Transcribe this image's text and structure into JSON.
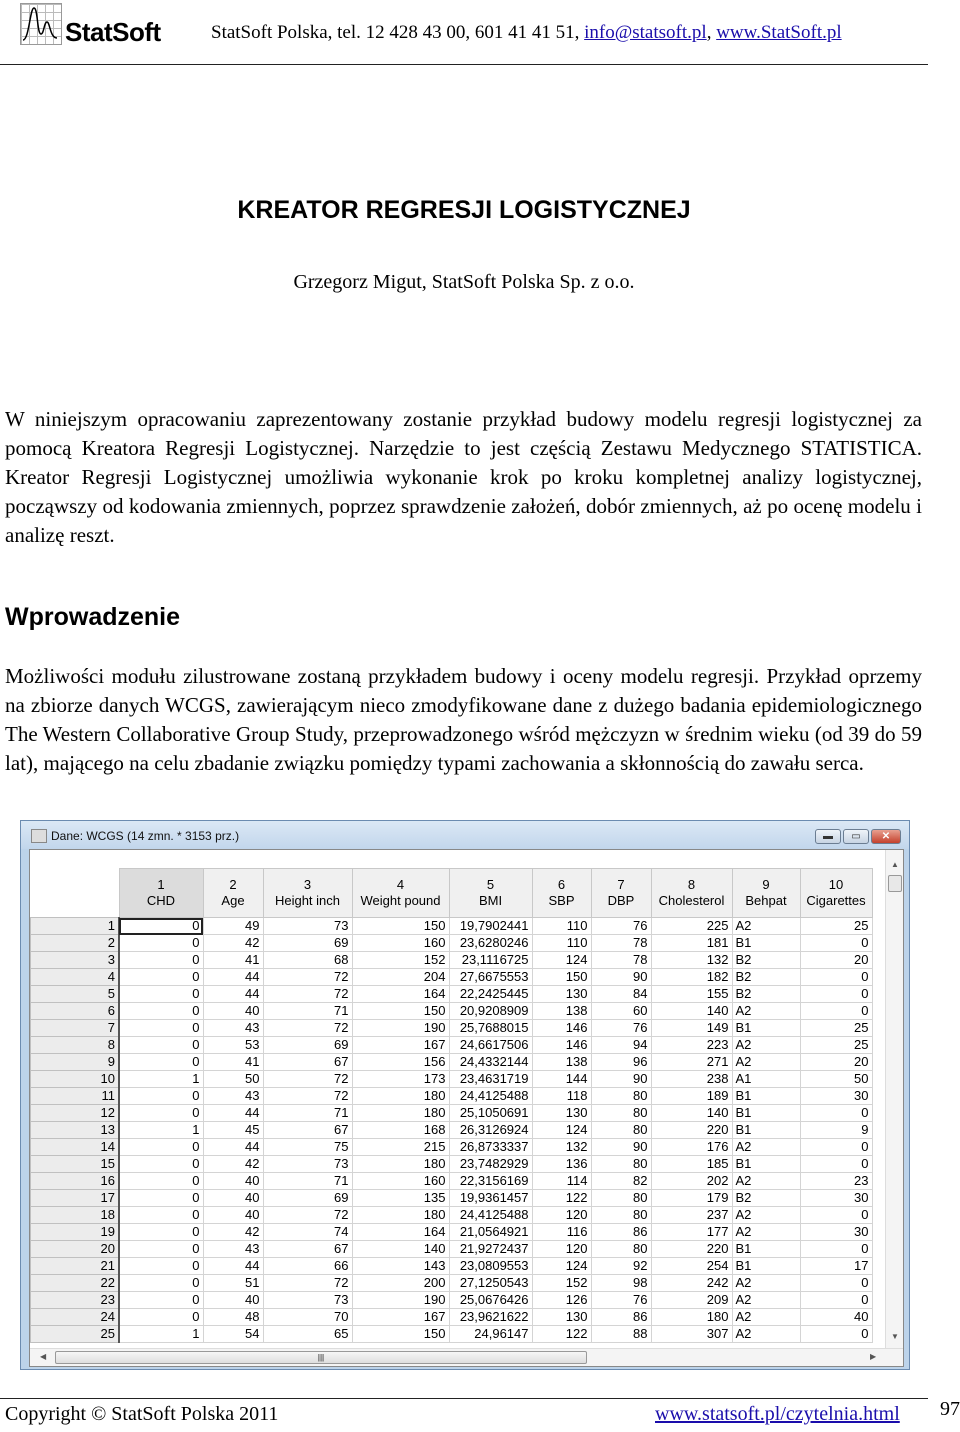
{
  "header": {
    "logo_text": "StatSoft",
    "contact_text": "StatSoft Polska, tel. 12 428 43 00, 601 41 41 51, ",
    "email": "info@statsoft.pl",
    "separator": ", ",
    "website": "www.StatSoft.pl"
  },
  "title": "KREATOR REGRESJI LOGISTYCZNEJ",
  "author": "Grzegorz Migut, StatSoft Polska Sp. z o.o.",
  "intro": "W niniejszym opracowaniu zaprezentowany zostanie przykład budowy modelu regresji logistycznej za pomocą Kreatora Regresji Logistycznej. Narzędzie to jest częścią Zestawu Medycznego STATISTICA. Kreator Regresji Logistycznej umożliwia wykonanie krok po kroku kompletnej analizy logistycznej, począwszy od kodowania zmiennych, poprzez sprawdzenie założeń, dobór zmiennych, aż po ocenę modelu i analizę reszt.",
  "section_heading": "Wprowadzenie",
  "section_text": "Możliwości modułu zilustrowane zostaną przykładem budowy i oceny modelu regresji. Przykład oprzemy na zbiorze danych WCGS, zawierającym nieco zmodyfikowane dane z dużego badania epidemiologicznego The Western Collaborative Group Study, przeprowadzonego wśród mężczyzn w średnim wieku (od 39 do 59 lat), mającego na celu zbadanie związku pomiędzy typami zachowania a skłonnością do zawału serca.",
  "spreadsheet": {
    "window_title": "Dane: WCGS (14 zmn. * 3153 prz.)",
    "columns": [
      {
        "num": "1",
        "name": "CHD"
      },
      {
        "num": "2",
        "name": "Age"
      },
      {
        "num": "3",
        "name": "Height inch"
      },
      {
        "num": "4",
        "name": "Weight pound"
      },
      {
        "num": "5",
        "name": "BMI"
      },
      {
        "num": "6",
        "name": "SBP"
      },
      {
        "num": "7",
        "name": "DBP"
      },
      {
        "num": "8",
        "name": "Cholesterol"
      },
      {
        "num": "9",
        "name": "Behpat"
      },
      {
        "num": "10",
        "name": "Cigarettes"
      }
    ],
    "rows": [
      [
        "1",
        "0",
        "49",
        "73",
        "150",
        "19,7902441",
        "110",
        "76",
        "225",
        "A2",
        "25"
      ],
      [
        "2",
        "0",
        "42",
        "69",
        "160",
        "23,6280246",
        "110",
        "78",
        "181",
        "B1",
        "0"
      ],
      [
        "3",
        "0",
        "41",
        "68",
        "152",
        "23,1116725",
        "124",
        "78",
        "132",
        "B2",
        "20"
      ],
      [
        "4",
        "0",
        "44",
        "72",
        "204",
        "27,6675553",
        "150",
        "90",
        "182",
        "B2",
        "0"
      ],
      [
        "5",
        "0",
        "44",
        "72",
        "164",
        "22,2425445",
        "130",
        "84",
        "155",
        "B2",
        "0"
      ],
      [
        "6",
        "0",
        "40",
        "71",
        "150",
        "20,9208909",
        "138",
        "60",
        "140",
        "A2",
        "0"
      ],
      [
        "7",
        "0",
        "43",
        "72",
        "190",
        "25,7688015",
        "146",
        "76",
        "149",
        "B1",
        "25"
      ],
      [
        "8",
        "0",
        "53",
        "69",
        "167",
        "24,6617506",
        "146",
        "94",
        "223",
        "A2",
        "25"
      ],
      [
        "9",
        "0",
        "41",
        "67",
        "156",
        "24,4332144",
        "138",
        "96",
        "271",
        "A2",
        "20"
      ],
      [
        "10",
        "1",
        "50",
        "72",
        "173",
        "23,4631719",
        "144",
        "90",
        "238",
        "A1",
        "50"
      ],
      [
        "11",
        "0",
        "43",
        "72",
        "180",
        "24,4125488",
        "118",
        "80",
        "189",
        "B1",
        "30"
      ],
      [
        "12",
        "0",
        "44",
        "71",
        "180",
        "25,1050691",
        "130",
        "80",
        "140",
        "B1",
        "0"
      ],
      [
        "13",
        "1",
        "45",
        "67",
        "168",
        "26,3126924",
        "124",
        "80",
        "220",
        "B1",
        "9"
      ],
      [
        "14",
        "0",
        "44",
        "75",
        "215",
        "26,8733337",
        "132",
        "90",
        "176",
        "A2",
        "0"
      ],
      [
        "15",
        "0",
        "42",
        "73",
        "180",
        "23,7482929",
        "136",
        "80",
        "185",
        "B1",
        "0"
      ],
      [
        "16",
        "0",
        "40",
        "71",
        "160",
        "22,3156169",
        "114",
        "82",
        "202",
        "A2",
        "23"
      ],
      [
        "17",
        "0",
        "40",
        "69",
        "135",
        "19,9361457",
        "122",
        "80",
        "179",
        "B2",
        "30"
      ],
      [
        "18",
        "0",
        "40",
        "72",
        "180",
        "24,4125488",
        "120",
        "80",
        "237",
        "A2",
        "0"
      ],
      [
        "19",
        "0",
        "42",
        "74",
        "164",
        "21,0564921",
        "116",
        "86",
        "177",
        "A2",
        "30"
      ],
      [
        "20",
        "0",
        "43",
        "67",
        "140",
        "21,9272437",
        "120",
        "80",
        "220",
        "B1",
        "0"
      ],
      [
        "21",
        "0",
        "44",
        "66",
        "143",
        "23,0809553",
        "124",
        "92",
        "254",
        "B1",
        "17"
      ],
      [
        "22",
        "0",
        "51",
        "72",
        "200",
        "27,1250543",
        "152",
        "98",
        "242",
        "A2",
        "0"
      ],
      [
        "23",
        "0",
        "40",
        "73",
        "190",
        "25,0676426",
        "126",
        "76",
        "209",
        "A2",
        "0"
      ],
      [
        "24",
        "0",
        "48",
        "70",
        "167",
        "23,9621622",
        "130",
        "86",
        "180",
        "A2",
        "40"
      ],
      [
        "25",
        "1",
        "54",
        "65",
        "150",
        "24,96147",
        "122",
        "88",
        "307",
        "A2",
        "0"
      ]
    ]
  },
  "footer": {
    "copyright": "Copyright © StatSoft Polska 2011",
    "link": "www.statsoft.pl/czytelnia.html",
    "page_number": "97"
  }
}
